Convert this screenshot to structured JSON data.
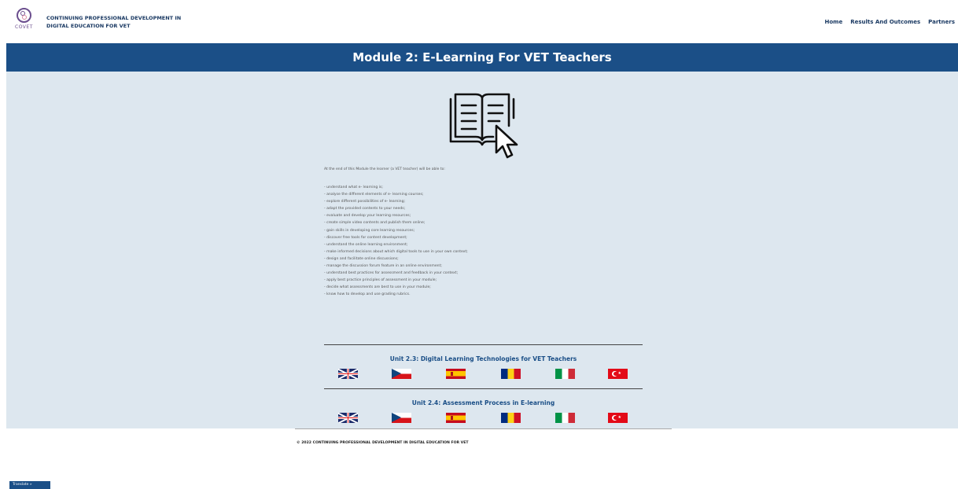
{
  "header": {
    "logo_text": "COVET",
    "site_title": "CONTINUING PROFESSIONAL DEVELOPMENT IN DIGITAL EDUCATION FOR VET",
    "nav": [
      "Home",
      "Results And Outcomes",
      "Partners"
    ]
  },
  "banner": {
    "title": "Module 2: E-Learning For VET Teachers"
  },
  "intro": "At the end of this Module the learner (a VET teacher) will be able to:",
  "objectives": [
    "- understand what e- learning is;",
    "- analyse the different elements of e- learning courses;",
    "- explore different possibilities of e- learning;",
    "- adapt the provided contents to your needs;",
    "- evaluate and develop your learning resources;",
    "- create simple video contents and publish them online;",
    "- gain skills in developing core learning resources;",
    "- discover free tools for content development;",
    "- understand the online learning environment;",
    "- make informed decisions about which digital tools to use in your own context;",
    "- design and facilitate online discussions;",
    "- manage the discussion forum feature in an online environment;",
    "- understand best practices for assessment and feedback in your context;",
    "- apply best practice principles of assessment in your module;",
    "- decide what assessments are best to use in your module;",
    "- know how to develop and use grading rubrics."
  ],
  "units": [
    {
      "title": "Unit 2.3: Digital Learning Technologies for VET Teachers"
    },
    {
      "title": "Unit 2.4: Assessment Process in E-learning"
    }
  ],
  "flags": [
    "uk-flag-icon",
    "czech-flag-icon",
    "spain-flag-icon",
    "romania-flag-icon",
    "italy-flag-icon",
    "turkey-flag-icon"
  ],
  "footer": {
    "copyright": "© 2022 CONTINUING PROFESSIONAL DEVELOPMENT IN DIGITAL EDUCATION FOR VET"
  },
  "translate": {
    "label": "Translate »"
  },
  "colors": {
    "brand_blue": "#1b4f87",
    "content_bg": "#dde7ef",
    "title_navy": "#1b3a63"
  }
}
